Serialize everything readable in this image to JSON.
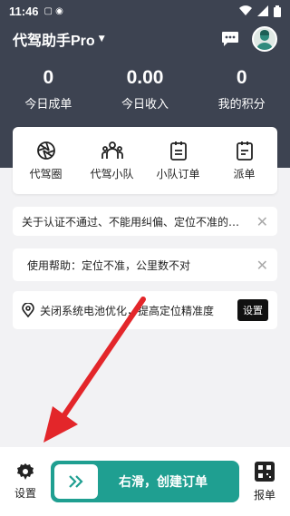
{
  "status": {
    "time": "11:46"
  },
  "header": {
    "title": "代驾助手Pro"
  },
  "stats": [
    {
      "value": "0",
      "label": "今日成单"
    },
    {
      "value": "0.00",
      "label": "今日收入"
    },
    {
      "value": "0",
      "label": "我的积分"
    }
  ],
  "menu": [
    {
      "label": "代驾圈",
      "icon": "aperture-icon"
    },
    {
      "label": "代驾小队",
      "icon": "team-icon"
    },
    {
      "label": "小队订单",
      "icon": "clipboard-icon"
    },
    {
      "label": "派单",
      "icon": "dispatch-icon"
    }
  ],
  "notices": [
    {
      "text": "关于认证不通过、不能用纠偏、定位不准的…"
    },
    {
      "text": "使用帮助：定位不准，公里数不对"
    },
    {
      "text": "关闭系统电池优化，提高定位精准度",
      "button": "设置"
    }
  ],
  "bottom": {
    "settings_label": "设置",
    "slider_text": "右滑，创建订单",
    "report_label": "报单"
  },
  "colors": {
    "header": "#3d4351",
    "accent": "#1f9f91",
    "arrow": "#e3262a"
  }
}
